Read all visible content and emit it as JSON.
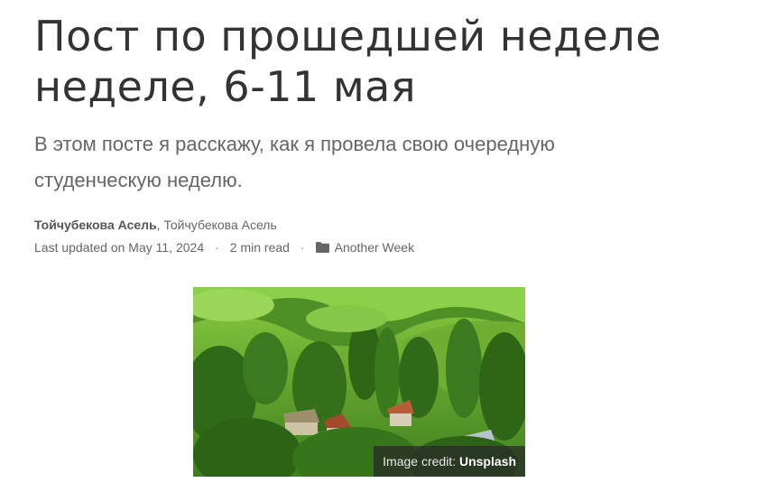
{
  "post": {
    "title": "Пост по прошедшей неделе неделе, 6-11 мая",
    "subtitle": "В этом посте я расскажу, как я провела свою очередную студенческую неделю.",
    "author_primary": "Тойчубекова Асель",
    "author_separator": ",",
    "author_secondary": "Тойчубекова Асель",
    "updated": "Last updated on May 11, 2024",
    "separator": "·",
    "read_time": "2 min read",
    "category": "Another Week",
    "category_icon": "folder-icon"
  },
  "image": {
    "credit_prefix": "Image credit:",
    "credit_source": "Unsplash"
  }
}
